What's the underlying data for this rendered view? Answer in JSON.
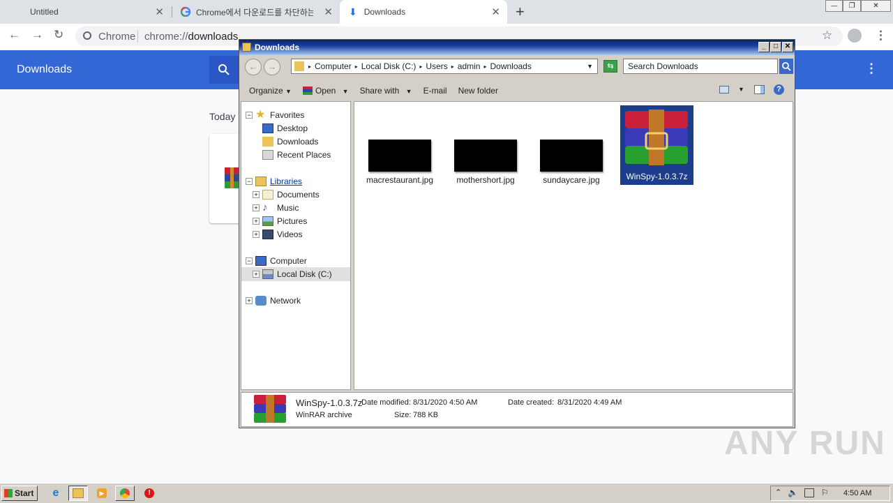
{
  "chrome": {
    "tabs": [
      {
        "title": "Untitled"
      },
      {
        "title": "Chrome에서 다운로드를 차단하는 경"
      },
      {
        "title": "Downloads"
      }
    ],
    "new_tab": "+",
    "window_controls": {
      "minimize": "—",
      "restore": "❐",
      "close": "✕"
    },
    "site_label": "Chrome",
    "url_prefix": "chrome://",
    "url_path": "downloads",
    "downloads_page": {
      "title": "Downloads",
      "section": "Today"
    }
  },
  "explorer": {
    "title": "Downloads",
    "breadcrumb": [
      "Computer",
      "Local Disk (C:)",
      "Users",
      "admin",
      "Downloads"
    ],
    "search_placeholder": "Search Downloads",
    "commands": {
      "organize": "Organize",
      "open": "Open",
      "share": "Share with",
      "email": "E-mail",
      "new_folder": "New folder"
    },
    "nav": {
      "favorites": "Favorites",
      "desktop": "Desktop",
      "downloads": "Downloads",
      "recent": "Recent Places",
      "libraries": "Libraries",
      "documents": "Documents",
      "music": "Music",
      "pictures": "Pictures",
      "videos": "Videos",
      "computer": "Computer",
      "local_disk": "Local Disk (C:)",
      "network": "Network"
    },
    "files": [
      {
        "name": "macrestaurant.jpg"
      },
      {
        "name": "mothershort.jpg"
      },
      {
        "name": "sundaycare.jpg"
      },
      {
        "name": "WinSpy-1.0.3.7z"
      }
    ],
    "details": {
      "name": "WinSpy-1.0.3.7z",
      "type": "WinRAR archive",
      "modified_label": "Date modified:",
      "modified": "8/31/2020 4:50 AM",
      "created_label": "Date created:",
      "created": "8/31/2020 4:49 AM",
      "size_label": "Size:",
      "size": "788 KB"
    }
  },
  "taskbar": {
    "start": "Start",
    "clock": "4:50 AM"
  },
  "watermark": "ANY RUN"
}
